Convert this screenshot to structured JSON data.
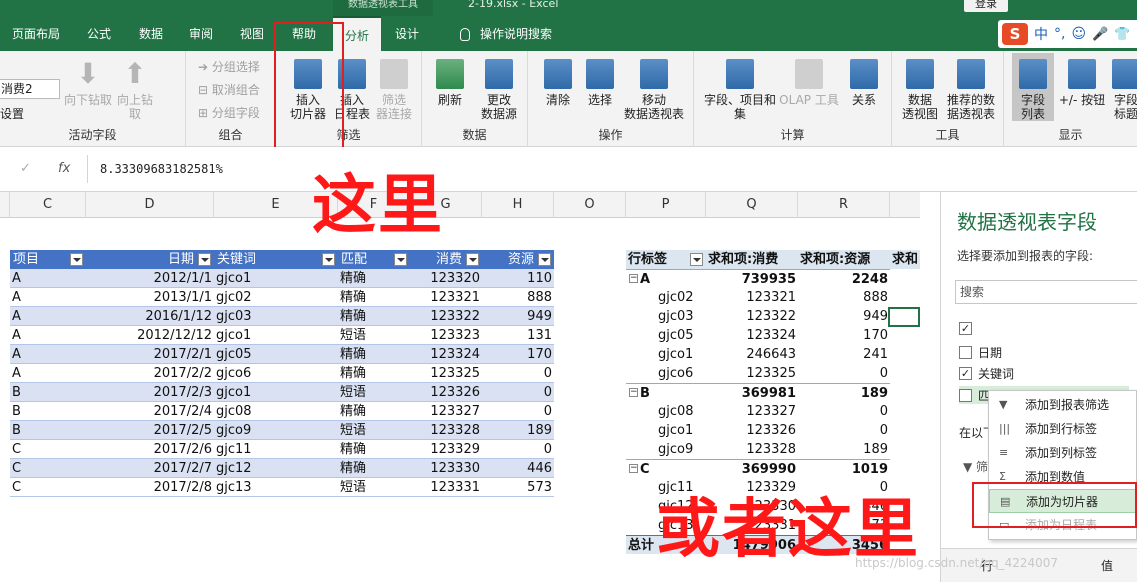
{
  "title_bar": {
    "context_tab": "数据透视表工具",
    "file_name": "2-19.xlsx  -  Excel",
    "login": "登录"
  },
  "tabs": [
    {
      "label": "页面布局"
    },
    {
      "label": "公式"
    },
    {
      "label": "数据"
    },
    {
      "label": "审阅"
    },
    {
      "label": "视图"
    },
    {
      "label": "帮助"
    },
    {
      "label": "分析"
    },
    {
      "label": "设计"
    }
  ],
  "tell_me": "操作说明搜索",
  "ime": {
    "s": "S",
    "lang": "中",
    "dots": "°,",
    "emoji": "☺",
    "mic": "🎤",
    "shirt": "👕"
  },
  "ribbon": {
    "active_field": {
      "value": "消费2",
      "settings": "设置",
      "label": "活动字段",
      "drill_down": "向下钻取",
      "drill_up": "向上钻取"
    },
    "group": {
      "selection": "分组选择",
      "ungroup": "取消组合",
      "field": "分组字段",
      "label": "组合"
    },
    "filter": {
      "slicer_l1": "插入",
      "slicer_l2": "切片器",
      "timeline_l1": "插入",
      "timeline_l2": "日程表",
      "conn_l1": "筛选",
      "conn_l2": "器连接",
      "label": "筛选"
    },
    "data": {
      "refresh": "刷新",
      "change_l1": "更改",
      "change_l2": "数据源",
      "label": "数据"
    },
    "actions": {
      "clear": "清除",
      "select": "选择",
      "move_l1": "移动",
      "move_l2": "数据透视表",
      "label": "操作"
    },
    "calc": {
      "fields_l1": "字段、项目和",
      "fields_l2": "集",
      "olap": "OLAP 工具",
      "relations": "关系",
      "label": "计算"
    },
    "tools": {
      "chart_l1": "数据",
      "chart_l2": "透视图",
      "rec_l1": "推荐的数",
      "rec_l2": "据透视表",
      "label": "工具"
    },
    "show": {
      "list_l1": "字段",
      "list_l2": "列表",
      "buttons": "+/- 按钮",
      "headers_l1": "字段",
      "headers_l2": "标题",
      "label": "显示"
    }
  },
  "formula_bar": {
    "cancel": "✓",
    "fx": "fx",
    "value": "8.33309683182581%"
  },
  "columns": [
    "C",
    "D",
    "E",
    "F",
    "G",
    "H",
    "O",
    "P",
    "Q",
    "R"
  ],
  "table": {
    "headers": [
      "项目",
      "日期",
      "关键词",
      "匹配",
      "消费",
      "资源"
    ],
    "rows": [
      [
        "A",
        "2012/1/1",
        "gjco1",
        "精确",
        "123320",
        "110"
      ],
      [
        "A",
        "2013/1/1",
        "gjc02",
        "精确",
        "123321",
        "888"
      ],
      [
        "A",
        "2016/1/12",
        "gjc03",
        "精确",
        "123322",
        "949"
      ],
      [
        "A",
        "2012/12/12",
        "gjco1",
        "短语",
        "123323",
        "131"
      ],
      [
        "A",
        "2017/2/1",
        "gjc05",
        "精确",
        "123324",
        "170"
      ],
      [
        "A",
        "2017/2/2",
        "gjco6",
        "精确",
        "123325",
        "0"
      ],
      [
        "B",
        "2017/2/3",
        "gjco1",
        "短语",
        "123326",
        "0"
      ],
      [
        "B",
        "2017/2/4",
        "gjc08",
        "精确",
        "123327",
        "0"
      ],
      [
        "B",
        "2017/2/5",
        "gjco9",
        "短语",
        "123328",
        "189"
      ],
      [
        "C",
        "2017/2/6",
        "gjc11",
        "精确",
        "123329",
        "0"
      ],
      [
        "C",
        "2017/2/7",
        "gjc12",
        "精确",
        "123330",
        "446"
      ],
      [
        "C",
        "2017/2/8",
        "gjc13",
        "短语",
        "123331",
        "573"
      ]
    ]
  },
  "pivot": {
    "headers": [
      "行标签",
      "求和项:消费",
      "求和项:资源",
      "求和"
    ],
    "rows": [
      [
        "A",
        "739935",
        "2248",
        "group"
      ],
      [
        "gjc02",
        "123321",
        "888",
        "item"
      ],
      [
        "gjc03",
        "123322",
        "949",
        "item"
      ],
      [
        "gjc05",
        "123324",
        "170",
        "item"
      ],
      [
        "gjco1",
        "246643",
        "241",
        "item"
      ],
      [
        "gjco6",
        "123325",
        "0",
        "item"
      ],
      [
        "B",
        "369981",
        "189",
        "group"
      ],
      [
        "gjc08",
        "123327",
        "0",
        "item"
      ],
      [
        "gjco1",
        "123326",
        "0",
        "item"
      ],
      [
        "gjco9",
        "123328",
        "189",
        "item"
      ],
      [
        "C",
        "369990",
        "1019",
        "group"
      ],
      [
        "gjc11",
        "123329",
        "0",
        "item"
      ],
      [
        "gjc12",
        "123330",
        "446",
        "item"
      ],
      [
        "gjc13",
        "123331",
        "573",
        "item"
      ]
    ],
    "total": [
      "总计",
      "1479906",
      "3456"
    ]
  },
  "annotations": {
    "here": "这里",
    "or_here": "或者这里"
  },
  "field_pane": {
    "title": "数据透视表字段",
    "subtitle": "选择要添加到报表的字段:",
    "search": "搜索",
    "fields": [
      {
        "label": "",
        "checked": true
      },
      {
        "label": "日期",
        "checked": false
      },
      {
        "label": "关键词",
        "checked": true
      },
      {
        "label": "匹配",
        "checked": false
      }
    ],
    "drag_text": "在以下",
    "filter_label": "筛",
    "rows_label": "行",
    "values_label": "值"
  },
  "context_menu": [
    {
      "label": "添加到报表筛选",
      "icon": "filter-icon"
    },
    {
      "label": "添加到行标签",
      "icon": "rows-icon"
    },
    {
      "label": "添加到列标签",
      "icon": "columns-icon"
    },
    {
      "label": "添加到数值",
      "icon": "sigma-icon"
    },
    {
      "label": "添加为切片器",
      "icon": "slicer-icon"
    },
    {
      "label": "添加为日程表",
      "icon": "timeline-icon"
    }
  ],
  "watermark": "https://blog.csdn.net/qq_4224007",
  "colors": {
    "excel_green": "#217346",
    "header_blue": "#4472c4",
    "band": "#d9e1f2",
    "annotation_red": "#ff1818"
  }
}
